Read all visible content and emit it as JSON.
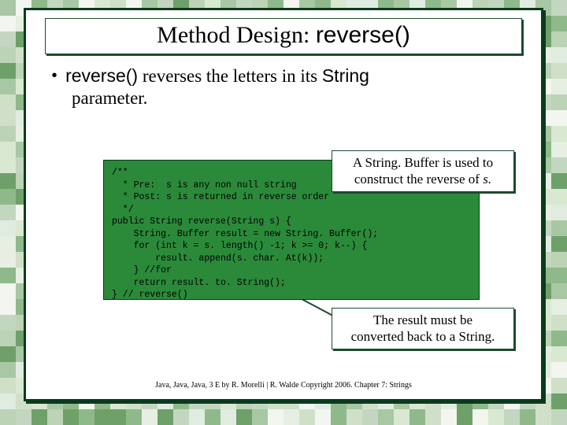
{
  "title": {
    "serif": "Method Design: ",
    "sans": "reverse()"
  },
  "bullet": {
    "sans1": "reverse()",
    "serif1": " reverses the letters in its ",
    "sans2": "String",
    "line2": "parameter."
  },
  "code": "/**\n  * Pre:  s is any non null string\n  * Post: s is returned in reverse order\n  */\npublic String reverse(String s) {\n    String. Buffer result = new String. Buffer();\n    for (int k = s. length() -1; k >= 0; k--) {\n        result. append(s. char. At(k));\n    } //for\n    return result. to. String();\n} // reverse()",
  "annot1": {
    "line1": "A String. Buffer is used to",
    "line2_a": "construct the reverse of ",
    "line2_b": "s."
  },
  "annot2": {
    "line1": "The result must be",
    "line2": "converted back to a String."
  },
  "footer": "Java, Java, Java, 3 E by R. Morelli | R. Walde     Copyright 2006.  Chapter 7: Strings"
}
